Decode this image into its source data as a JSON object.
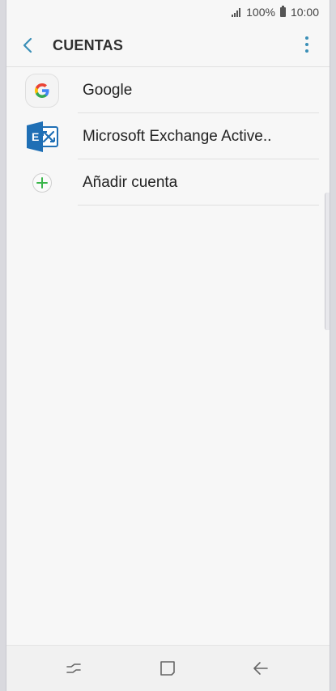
{
  "status_bar": {
    "battery_percent": "100%",
    "time": "10:00",
    "signal_icon": "signal-icon",
    "battery_icon": "battery-icon"
  },
  "app_bar": {
    "title": "CUENTAS",
    "back_icon": "back-arrow-icon",
    "menu_icon": "more-options-icon"
  },
  "accounts": [
    {
      "label": "Google",
      "icon": "google-icon"
    },
    {
      "label": "Microsoft Exchange Active..",
      "icon": "exchange-icon"
    },
    {
      "label": "Añadir cuenta",
      "icon": "add-icon"
    }
  ],
  "nav_bar": {
    "recent_icon": "recent-apps-icon",
    "home_icon": "home-icon",
    "back_icon": "back-icon"
  },
  "colors": {
    "accent": "#3a8fb7",
    "add_icon": "#39b54a",
    "exchange": "#1f6fb5"
  }
}
